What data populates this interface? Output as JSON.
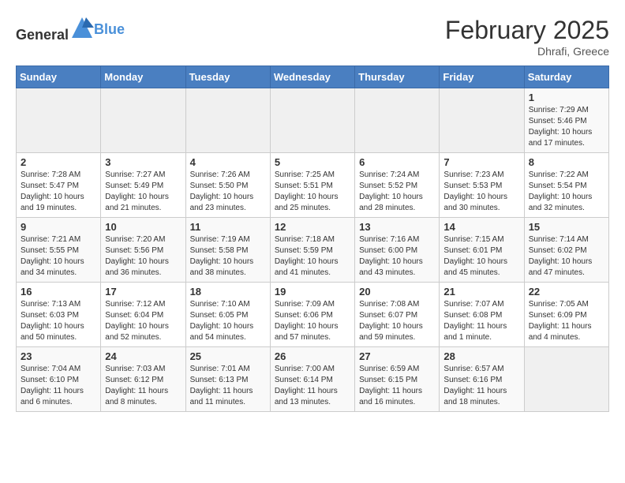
{
  "header": {
    "logo_general": "General",
    "logo_blue": "Blue",
    "month_year": "February 2025",
    "location": "Dhrafi, Greece"
  },
  "days_of_week": [
    "Sunday",
    "Monday",
    "Tuesday",
    "Wednesday",
    "Thursday",
    "Friday",
    "Saturday"
  ],
  "weeks": [
    {
      "days": [
        {
          "num": "",
          "info": ""
        },
        {
          "num": "",
          "info": ""
        },
        {
          "num": "",
          "info": ""
        },
        {
          "num": "",
          "info": ""
        },
        {
          "num": "",
          "info": ""
        },
        {
          "num": "",
          "info": ""
        },
        {
          "num": "1",
          "info": "Sunrise: 7:29 AM\nSunset: 5:46 PM\nDaylight: 10 hours and 17 minutes."
        }
      ]
    },
    {
      "days": [
        {
          "num": "2",
          "info": "Sunrise: 7:28 AM\nSunset: 5:47 PM\nDaylight: 10 hours and 19 minutes."
        },
        {
          "num": "3",
          "info": "Sunrise: 7:27 AM\nSunset: 5:49 PM\nDaylight: 10 hours and 21 minutes."
        },
        {
          "num": "4",
          "info": "Sunrise: 7:26 AM\nSunset: 5:50 PM\nDaylight: 10 hours and 23 minutes."
        },
        {
          "num": "5",
          "info": "Sunrise: 7:25 AM\nSunset: 5:51 PM\nDaylight: 10 hours and 25 minutes."
        },
        {
          "num": "6",
          "info": "Sunrise: 7:24 AM\nSunset: 5:52 PM\nDaylight: 10 hours and 28 minutes."
        },
        {
          "num": "7",
          "info": "Sunrise: 7:23 AM\nSunset: 5:53 PM\nDaylight: 10 hours and 30 minutes."
        },
        {
          "num": "8",
          "info": "Sunrise: 7:22 AM\nSunset: 5:54 PM\nDaylight: 10 hours and 32 minutes."
        }
      ]
    },
    {
      "days": [
        {
          "num": "9",
          "info": "Sunrise: 7:21 AM\nSunset: 5:55 PM\nDaylight: 10 hours and 34 minutes."
        },
        {
          "num": "10",
          "info": "Sunrise: 7:20 AM\nSunset: 5:56 PM\nDaylight: 10 hours and 36 minutes."
        },
        {
          "num": "11",
          "info": "Sunrise: 7:19 AM\nSunset: 5:58 PM\nDaylight: 10 hours and 38 minutes."
        },
        {
          "num": "12",
          "info": "Sunrise: 7:18 AM\nSunset: 5:59 PM\nDaylight: 10 hours and 41 minutes."
        },
        {
          "num": "13",
          "info": "Sunrise: 7:16 AM\nSunset: 6:00 PM\nDaylight: 10 hours and 43 minutes."
        },
        {
          "num": "14",
          "info": "Sunrise: 7:15 AM\nSunset: 6:01 PM\nDaylight: 10 hours and 45 minutes."
        },
        {
          "num": "15",
          "info": "Sunrise: 7:14 AM\nSunset: 6:02 PM\nDaylight: 10 hours and 47 minutes."
        }
      ]
    },
    {
      "days": [
        {
          "num": "16",
          "info": "Sunrise: 7:13 AM\nSunset: 6:03 PM\nDaylight: 10 hours and 50 minutes."
        },
        {
          "num": "17",
          "info": "Sunrise: 7:12 AM\nSunset: 6:04 PM\nDaylight: 10 hours and 52 minutes."
        },
        {
          "num": "18",
          "info": "Sunrise: 7:10 AM\nSunset: 6:05 PM\nDaylight: 10 hours and 54 minutes."
        },
        {
          "num": "19",
          "info": "Sunrise: 7:09 AM\nSunset: 6:06 PM\nDaylight: 10 hours and 57 minutes."
        },
        {
          "num": "20",
          "info": "Sunrise: 7:08 AM\nSunset: 6:07 PM\nDaylight: 10 hours and 59 minutes."
        },
        {
          "num": "21",
          "info": "Sunrise: 7:07 AM\nSunset: 6:08 PM\nDaylight: 11 hours and 1 minute."
        },
        {
          "num": "22",
          "info": "Sunrise: 7:05 AM\nSunset: 6:09 PM\nDaylight: 11 hours and 4 minutes."
        }
      ]
    },
    {
      "days": [
        {
          "num": "23",
          "info": "Sunrise: 7:04 AM\nSunset: 6:10 PM\nDaylight: 11 hours and 6 minutes."
        },
        {
          "num": "24",
          "info": "Sunrise: 7:03 AM\nSunset: 6:12 PM\nDaylight: 11 hours and 8 minutes."
        },
        {
          "num": "25",
          "info": "Sunrise: 7:01 AM\nSunset: 6:13 PM\nDaylight: 11 hours and 11 minutes."
        },
        {
          "num": "26",
          "info": "Sunrise: 7:00 AM\nSunset: 6:14 PM\nDaylight: 11 hours and 13 minutes."
        },
        {
          "num": "27",
          "info": "Sunrise: 6:59 AM\nSunset: 6:15 PM\nDaylight: 11 hours and 16 minutes."
        },
        {
          "num": "28",
          "info": "Sunrise: 6:57 AM\nSunset: 6:16 PM\nDaylight: 11 hours and 18 minutes."
        },
        {
          "num": "",
          "info": ""
        }
      ]
    }
  ]
}
